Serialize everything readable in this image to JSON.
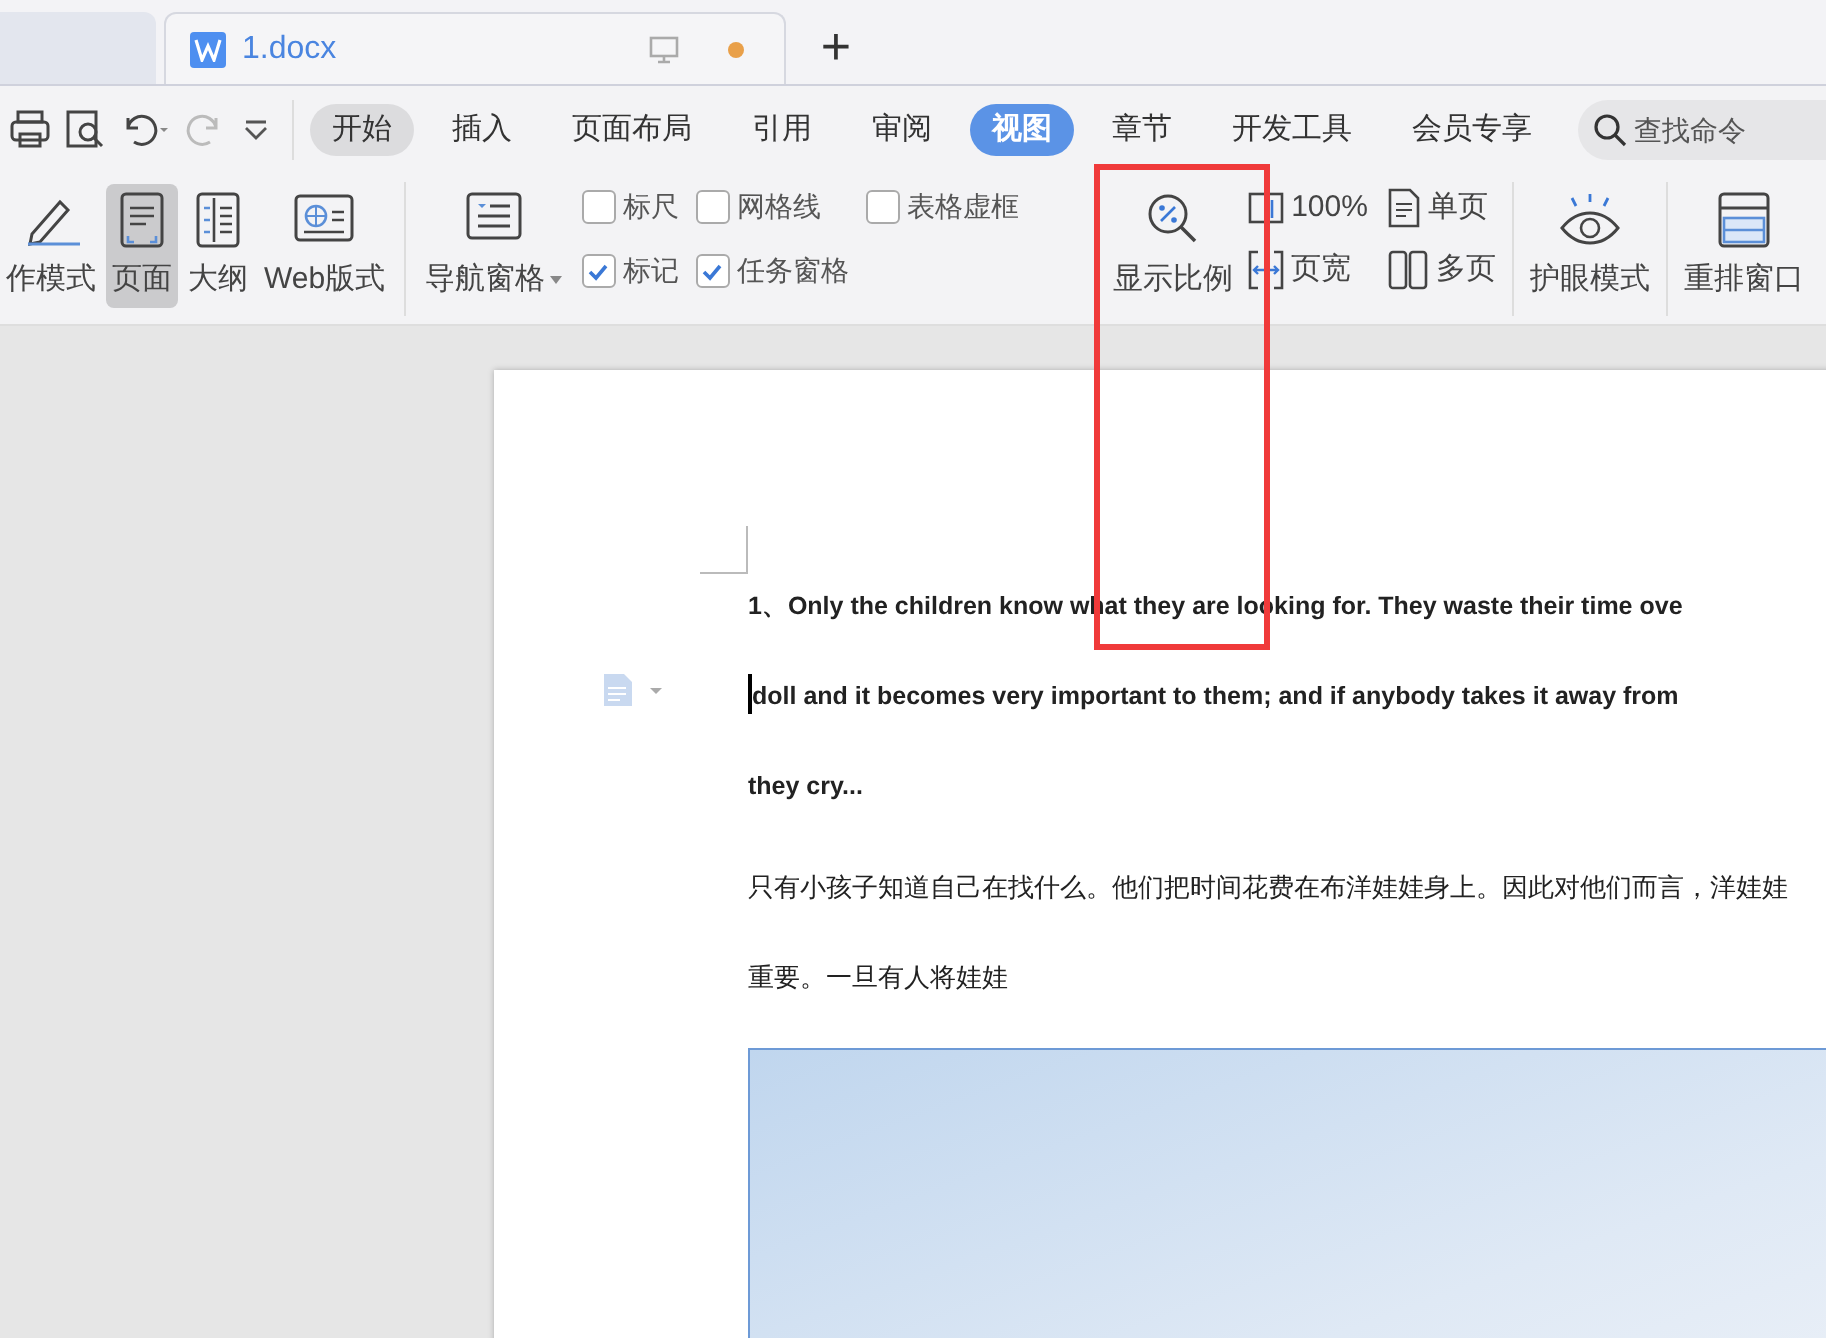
{
  "document_tab": {
    "title": "1.docx",
    "unsaved": true
  },
  "new_tab_button": "+",
  "menu_tabs": [
    {
      "label": "开始",
      "selected": false,
      "hovered": true
    },
    {
      "label": "插入",
      "selected": false,
      "hovered": false
    },
    {
      "label": "页面布局",
      "selected": false,
      "hovered": false
    },
    {
      "label": "引用",
      "selected": false,
      "hovered": false
    },
    {
      "label": "审阅",
      "selected": false,
      "hovered": false
    },
    {
      "label": "视图",
      "selected": true,
      "hovered": false
    },
    {
      "label": "章节",
      "selected": false,
      "hovered": false
    },
    {
      "label": "开发工具",
      "selected": false,
      "hovered": false
    },
    {
      "label": "会员专享",
      "selected": false,
      "hovered": false
    }
  ],
  "search": {
    "placeholder": "查找命令"
  },
  "view_modes": [
    {
      "label": "作模式",
      "kind": "pencil",
      "selected": false
    },
    {
      "label": "页面",
      "kind": "page",
      "selected": true
    },
    {
      "label": "大纲",
      "kind": "outline",
      "selected": false
    },
    {
      "label": "Web版式",
      "kind": "web",
      "selected": false
    }
  ],
  "nav_pane": {
    "label": "导航窗格"
  },
  "checkboxes": [
    {
      "label": "标尺",
      "checked": false
    },
    {
      "label": "网格线",
      "checked": false
    },
    {
      "label": "表格虚框",
      "checked": false
    },
    {
      "label": "标记",
      "checked": true
    },
    {
      "label": "任务窗格",
      "checked": true
    }
  ],
  "zoom": {
    "label": "显示比例",
    "actual_size": "100%",
    "page_width": "页宽",
    "single_page": "单页",
    "multi_page": "多页"
  },
  "eye_mode": {
    "label": "护眼模式"
  },
  "rearrange": {
    "label": "重排窗口"
  },
  "document_lines": [
    {
      "text": "1、Only the children know what they are looking for. They waste their time ove",
      "bold": true,
      "cursor": false
    },
    {
      "text": "doll and it becomes very important to them; and if anybody takes it away from",
      "bold": true,
      "cursor": true
    },
    {
      "text": "they cry...",
      "bold": true,
      "cursor": false
    },
    {
      "text": "只有小孩子知道自己在找什么。他们把时间花费在布洋娃娃身上。因此对他们而言，洋娃娃",
      "bold": false,
      "cursor": false
    },
    {
      "text": "重要。一旦有人将娃娃",
      "bold": false,
      "cursor": false
    }
  ]
}
